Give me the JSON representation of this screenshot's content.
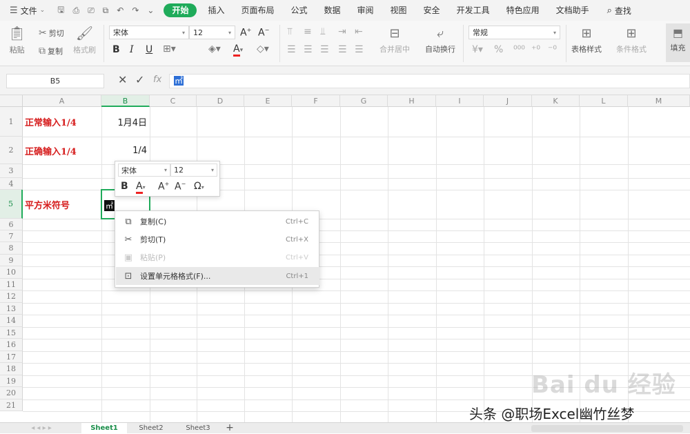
{
  "menubar": {
    "file_label": "文件",
    "tabs": [
      "开始",
      "插入",
      "页面布局",
      "公式",
      "数据",
      "审阅",
      "视图",
      "安全",
      "开发工具",
      "特色应用",
      "文档助手"
    ],
    "active_tab": "开始",
    "search_label": "查找"
  },
  "ribbon": {
    "format_painter": "格式刷",
    "cut": "剪切",
    "copy": "复制",
    "paste": "粘贴",
    "font_name": "宋体",
    "font_size": "12",
    "merge_center": "合并居中",
    "wrap_text": "自动换行",
    "number_format": "常规",
    "table_style": "表格样式",
    "cond_format": "条件格式",
    "fill": "填充"
  },
  "formula_bar": {
    "name_box": "B5",
    "value": "㎡"
  },
  "columns": [
    "A",
    "B",
    "C",
    "D",
    "E",
    "F",
    "G",
    "H",
    "I",
    "J",
    "K",
    "L",
    "M"
  ],
  "active_column": "B",
  "rows": [
    "1",
    "2",
    "3",
    "4",
    "5",
    "6",
    "7",
    "8",
    "9",
    "10",
    "11",
    "12",
    "13",
    "14",
    "15",
    "16",
    "17",
    "18",
    "19",
    "20",
    "21"
  ],
  "active_row": "5",
  "cells": {
    "a1": "正常输入1/4",
    "b1": "1月4日",
    "a2": "正确输入1/4",
    "b2": "1/4",
    "a5": "平方米符号",
    "b5": "㎡"
  },
  "mini_toolbar": {
    "font_name": "宋体",
    "font_size": "12"
  },
  "context_menu": {
    "items": [
      {
        "label": "复制(C)",
        "shortcut": "Ctrl+C"
      },
      {
        "label": "剪切(T)",
        "shortcut": "Ctrl+X"
      },
      {
        "label": "粘贴(P)",
        "shortcut": "Ctrl+V"
      },
      {
        "label": "设置单元格格式(F)...",
        "shortcut": "Ctrl+1"
      }
    ]
  },
  "sheets": [
    "Sheet1",
    "Sheet2",
    "Sheet3"
  ],
  "active_sheet": "Sheet1",
  "watermarks": {
    "baidu": "Bai du 经验",
    "author": "头条 @职场Excel幽竹丝梦"
  },
  "colors": {
    "accent": "#1fab5a",
    "red_text": "#d61d1d"
  }
}
